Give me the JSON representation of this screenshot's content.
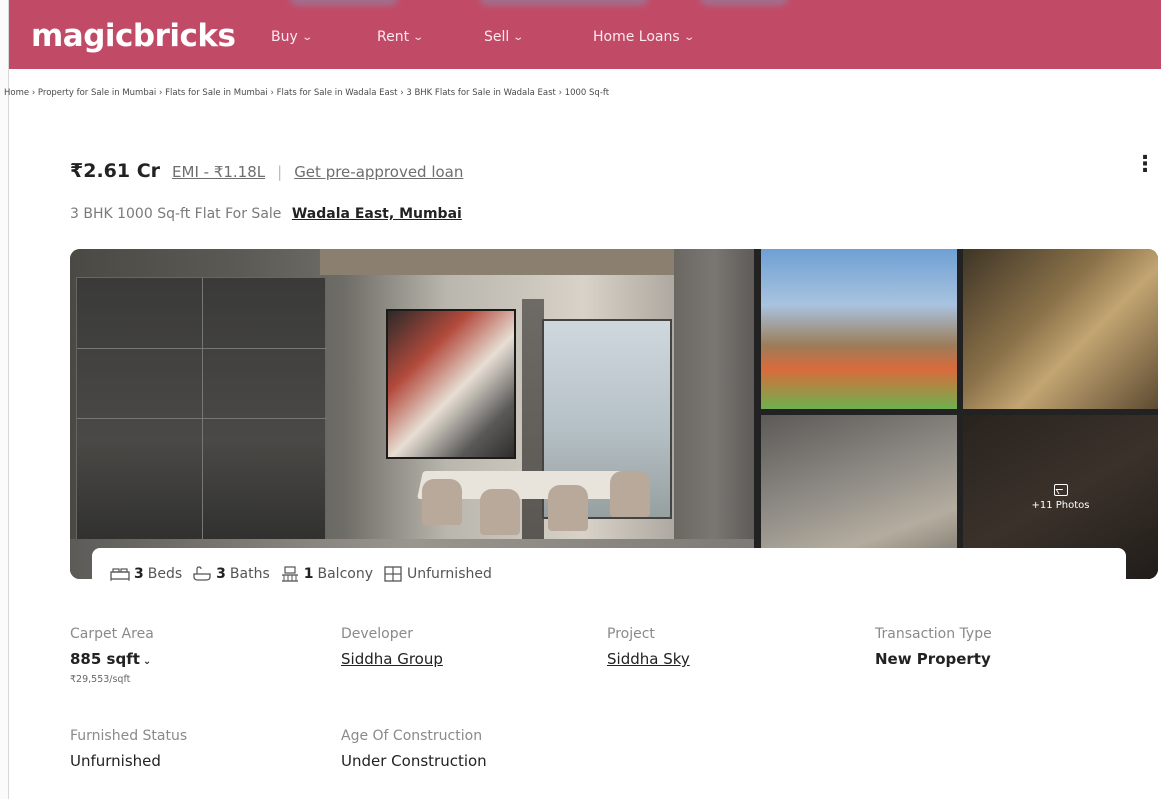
{
  "header": {
    "logo": "magicbricks",
    "nav": [
      {
        "label": "Buy"
      },
      {
        "label": "Rent"
      },
      {
        "label": "Sell"
      },
      {
        "label": "Home Loans"
      }
    ]
  },
  "breadcrumb": [
    "Home",
    "Property for Sale in Mumbai",
    "Flats for Sale in Mumbai",
    "Flats for Sale in Wadala East",
    "3 BHK Flats for Sale in Wadala East",
    "1000 Sq-ft"
  ],
  "listing": {
    "price": "₹2.61 Cr",
    "emi_link": "EMI - ₹1.18L",
    "separator": "|",
    "loan_link": "Get pre-approved loan",
    "title": "3 BHK 1000 Sq-ft Flat For Sale",
    "location": "Wadala East, Mumbai"
  },
  "gallery": {
    "more_photos": "+11 Photos"
  },
  "features": [
    {
      "icon": "bed-icon",
      "value": "3",
      "label": "Beds"
    },
    {
      "icon": "bath-icon",
      "value": "3",
      "label": "Baths"
    },
    {
      "icon": "balcony-icon",
      "value": "1",
      "label": "Balcony"
    },
    {
      "icon": "furnishing-icon",
      "value": "",
      "label": "Unfurnished"
    }
  ],
  "details": {
    "carpet_area": {
      "label": "Carpet Area",
      "value": "885 sqft",
      "sub": "₹29,553/sqft"
    },
    "developer": {
      "label": "Developer",
      "value": "Siddha Group"
    },
    "project": {
      "label": "Project",
      "value": "Siddha Sky"
    },
    "transaction": {
      "label": "Transaction Type",
      "value": "New Property"
    },
    "furnished": {
      "label": "Furnished Status",
      "value": "Unfurnished"
    },
    "age": {
      "label": "Age Of Construction",
      "value": "Under Construction"
    }
  },
  "colors": {
    "brand": "#c14b67",
    "text_dark": "#222222",
    "text_muted": "#8a8a8a"
  }
}
